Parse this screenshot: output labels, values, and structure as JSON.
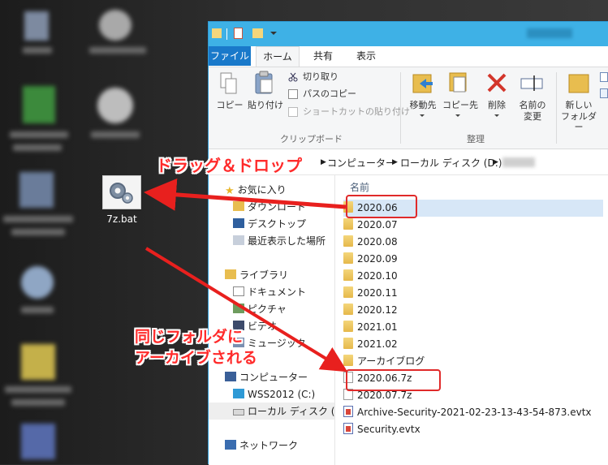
{
  "desktop": {
    "bat_label": "7z.bat"
  },
  "ribbon": {
    "tabs": [
      "ファイル",
      "ホーム",
      "共有",
      "表示"
    ],
    "clipboard": {
      "copy": "コピー",
      "paste": "貼り付け",
      "cut": "切り取り",
      "copy_path": "パスのコピー",
      "paste_shortcut": "ショートカットの貼り付け",
      "group": "クリップボード"
    },
    "organize": {
      "move_to": "移動先",
      "copy_to": "コピー先",
      "delete": "削除",
      "rename_line1": "名前の",
      "rename_line2": "変更",
      "group": "整理"
    },
    "new": {
      "new_folder_line1": "新しい",
      "new_folder_line2": "フォルダー"
    }
  },
  "address": {
    "parts": [
      "コンピューター",
      "ローカル ディスク (D:)"
    ]
  },
  "nav": {
    "favorites": "お気に入り",
    "downloads": "ダウンロード",
    "desktop": "デスクトップ",
    "recent": "最近表示した場所",
    "libraries": "ライブラリ",
    "documents": "ドキュメント",
    "pictures": "ピクチャ",
    "videos": "ビデオ",
    "music": "ミュージック",
    "computer": "コンピューター",
    "drive_c": "WSS2012 (C:)",
    "drive_d": "ローカル ディスク (D:)",
    "network": "ネットワーク"
  },
  "filelist": {
    "column_name": "名前",
    "items": [
      {
        "name": "2020.06",
        "type": "folder"
      },
      {
        "name": "2020.07",
        "type": "folder"
      },
      {
        "name": "2020.08",
        "type": "folder"
      },
      {
        "name": "2020.09",
        "type": "folder"
      },
      {
        "name": "2020.10",
        "type": "folder"
      },
      {
        "name": "2020.11",
        "type": "folder"
      },
      {
        "name": "2020.12",
        "type": "folder"
      },
      {
        "name": "2021.01",
        "type": "folder"
      },
      {
        "name": "2021.02",
        "type": "folder"
      },
      {
        "name": "アーカイブログ",
        "type": "folder"
      },
      {
        "name": "2020.06.7z",
        "type": "file"
      },
      {
        "name": "2020.07.7z",
        "type": "file"
      },
      {
        "name": "Archive-Security-2021-02-23-13-43-54-873.evtx",
        "type": "evtx"
      },
      {
        "name": "Security.evtx",
        "type": "evtx"
      }
    ]
  },
  "annotations": {
    "drag_drop": "ドラッグ＆ドロップ",
    "archived_line1": "同じフォルダに",
    "archived_line2": "アーカイブされる",
    "color": "#ff2b2b"
  }
}
